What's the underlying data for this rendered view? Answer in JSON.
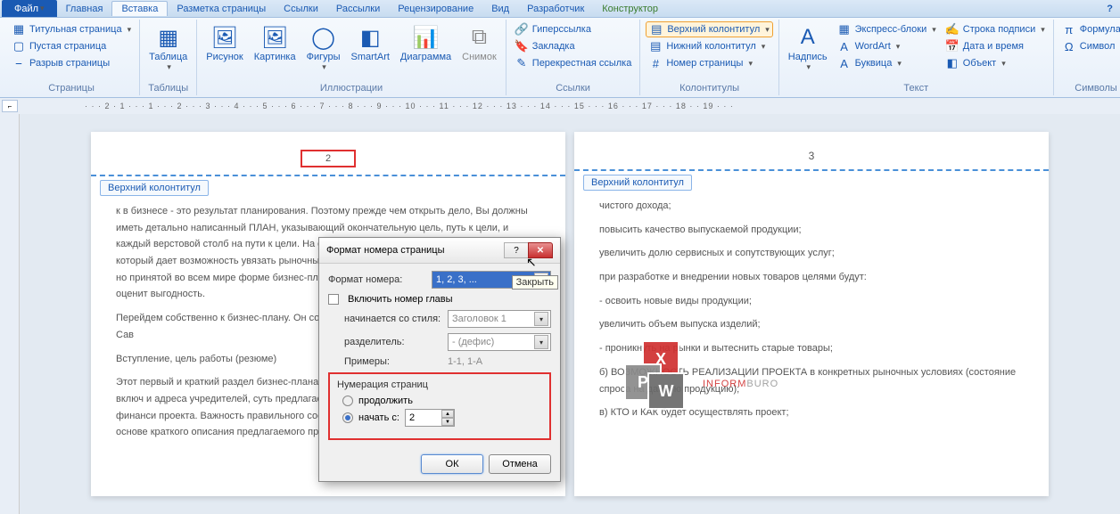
{
  "tabs": {
    "file": "Файл",
    "home": "Главная",
    "insert": "Вставка",
    "layout": "Разметка страницы",
    "refs": "Ссылки",
    "mail": "Рассылки",
    "review": "Рецензирование",
    "view": "Вид",
    "dev": "Разработчик",
    "designer": "Конструктор"
  },
  "ribbon": {
    "pages": {
      "title_page": "Титульная страница",
      "blank": "Пустая страница",
      "break": "Разрыв страницы",
      "group": "Страницы"
    },
    "tables": {
      "table": "Таблица",
      "group": "Таблицы"
    },
    "illus": {
      "picture": "Рисунок",
      "clip": "Картинка",
      "shapes": "Фигуры",
      "smartart": "SmartArt",
      "chart": "Диаграмма",
      "screenshot": "Снимок",
      "group": "Иллюстрации"
    },
    "links": {
      "hyperlink": "Гиперссылка",
      "bookmark": "Закладка",
      "crossref": "Перекрестная ссылка",
      "group": "Ссылки"
    },
    "hf": {
      "header": "Верхний колонтитул",
      "footer": "Нижний колонтитул",
      "pagenum": "Номер страницы",
      "group": "Колонтитулы"
    },
    "text": {
      "textbox": "Надпись",
      "quickparts": "Экспресс-блоки",
      "wordart": "WordArt",
      "dropcap": "Буквица",
      "sigline": "Строка подписи",
      "datetime": "Дата и время",
      "object": "Объект",
      "group": "Текст"
    },
    "sym": {
      "equation": "Формула",
      "symbol": "Символ",
      "group": "Символы"
    }
  },
  "page_left": {
    "num": "2",
    "tag": "Верхний колонтитул",
    "p1": "к в бизнесе - это результат планирования. Поэтому прежде чем открыть дело, Вы должны иметь детально написанный ПЛАН, указывающий окончательную цель, путь к цели, и каждый верстовой столб на пути к цели. На основе этого и разрабатывается бизнес-план, который дает возможность увязать рыночные предприятии. Материалы, обосновывающие но принятой во всем мире форме бизнес-плана, ко руководству предприятия комплексно оценит выгодность.",
    "p2": "Перейдем собственно к бизнес-плану. Он состо написанию взяты из учебного пособия В.Д. Сав",
    "p3": "Вступление, цель работы (резюме)",
    "p4": "Этот первый и краткий раздел бизнес-плана со последующих разделов. Титульный лист включ и адреса учредителей, суть предлагаемого про потребность во внешних источниках финанси проекта. Важность правильного составления в потенциальные инвесторы на основе краткого описания предлагаемого проекта"
  },
  "page_right": {
    "num": "3",
    "tag": "Верхний колонтитул",
    "l1": "чистого дохода;",
    "l2": "повысить качество выпускаемой продукции;",
    "l3": "увеличить долю сервисных и сопутствующих услуг;",
    "l4": "при разработке и внедрении новых товаров целями будут:",
    "l5": "- освоить новые виды продукции;",
    "l6": "увеличить объем выпуска изделий;",
    "l7": "- проникнуть на рынки и вытеснить старые товары;",
    "l8": "б) ВОЗМОЖНОСТЬ РЕАЛИЗАЦИИ ПРОЕКТА в конкретных рыночных условиях (состояние спроса на данную продукцию);",
    "l9": "в) КТО и КАК будет осуществлять проект;"
  },
  "dialog": {
    "title": "Формат номера страницы",
    "tooltip": "Закрыть",
    "format_label": "Формат номера:",
    "format_value": "1, 2, 3, ...",
    "include": "Включить номер главы",
    "starts_label": "начинается со стиля:",
    "starts_value": "Заголовок 1",
    "sep_label": "разделитель:",
    "sep_value": "- (дефис)",
    "examples_label": "Примеры:",
    "examples_value": "1-1, 1-A",
    "numbering": "Нумерация страниц",
    "continue": "продолжить",
    "startat": "начать с:",
    "startat_value": "2",
    "ok": "ОК",
    "cancel": "Отмена"
  },
  "ruler": "· · · 2 · 1 · · · 1 · · · 2 · · · 3 · · · 4 · · · 5 · · · 6 · · · 7 · · · 8 · · · 9 · · · 10 · · · 11 · · · 12 · · · 13 · · · 14 · · · 15 · · · 16 · · · 17 · · · 18 · · 19 · · ·",
  "watermark": {
    "t1": "INFORM",
    "t2": "BURO"
  }
}
